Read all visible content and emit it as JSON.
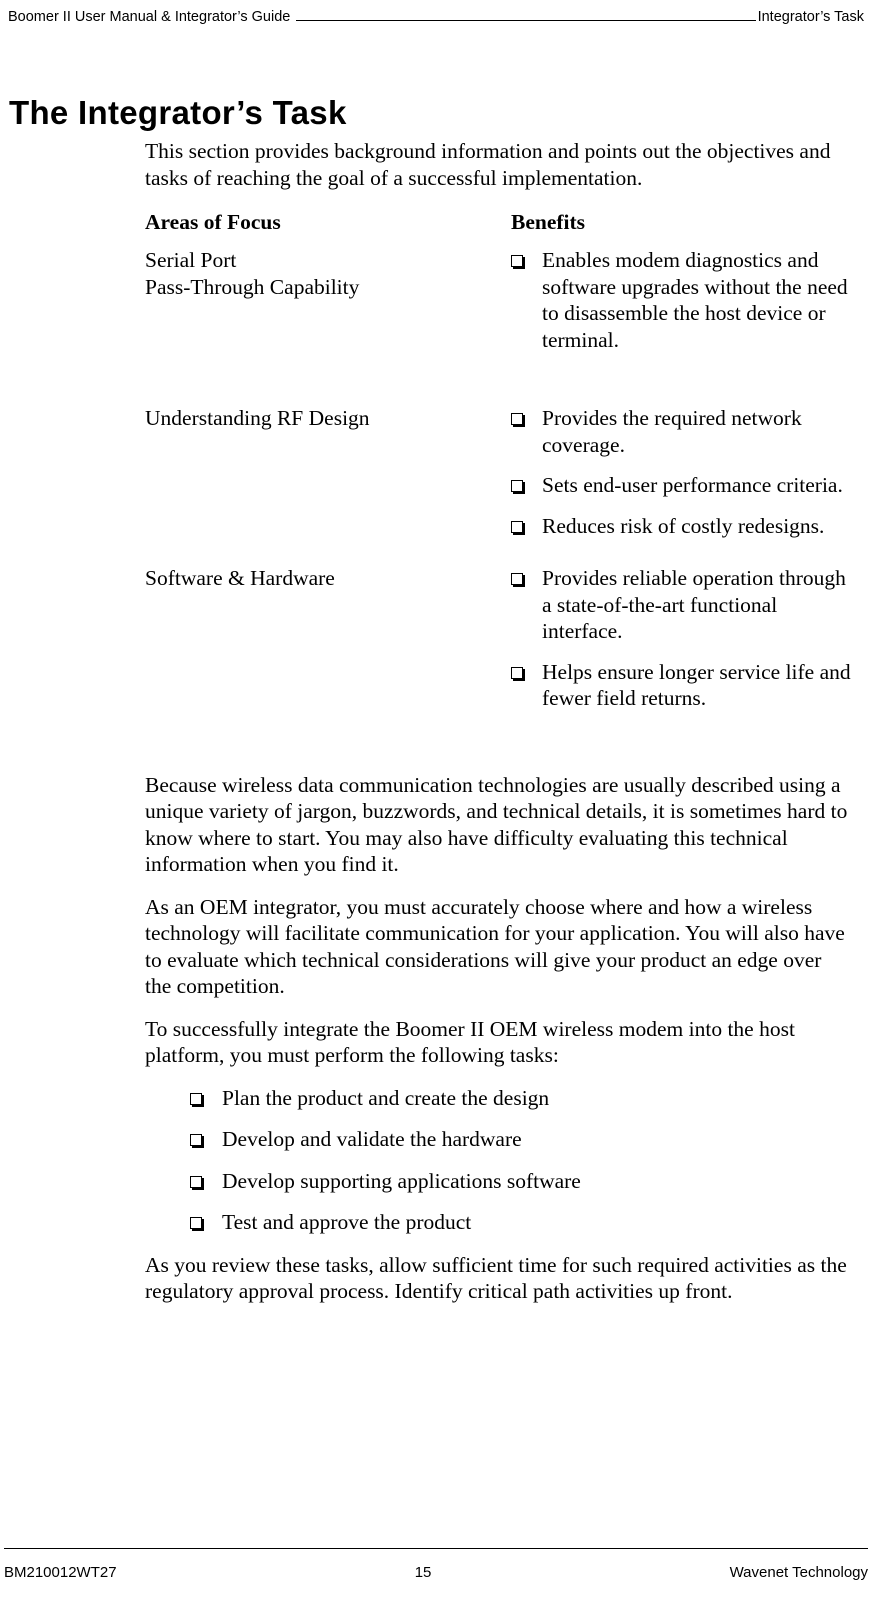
{
  "header": {
    "left_text": "Boomer II User Manual & Integrator’s Guide",
    "right_text": "Integrator’s Task"
  },
  "title": "The Integrator’s Task",
  "intro_paragraph": "This section provides background information and points out the objectives and tasks of reaching the goal of a successful implementation.",
  "focus_table": {
    "headers": {
      "focus": "Areas of Focus",
      "benefits": "Benefits"
    },
    "rows": [
      {
        "focus": "Serial Port\nPass-Through Capability",
        "focus_line1": "Serial Port",
        "focus_line2": "Pass-Through Capability",
        "benefits": [
          "Enables modem diagnostics and software upgrades without the need to disassemble the host device or terminal."
        ]
      },
      {
        "focus": "Understanding RF Design",
        "focus_line1": "Understanding RF Design",
        "focus_line2": "",
        "benefits": [
          "Provides the required network coverage.",
          "Sets end-user performance criteria.",
          "Reduces risk of costly redesigns."
        ]
      },
      {
        "focus": "Software & Hardware",
        "focus_line1": "Software & Hardware",
        "focus_line2": "",
        "benefits": [
          "Provides reliable operation through a state-of-the-art functional interface.",
          "Helps ensure longer service life and fewer field returns."
        ]
      }
    ]
  },
  "body_paragraphs": [
    "Because wireless data communication technologies are usually described using a unique variety of jargon, buzzwords, and technical details, it is sometimes hard to know where to start. You may also have difficulty evaluating this technical information when you find it.",
    "As an OEM integrator, you must accurately choose where and how a wireless technology will facilitate communication for your application. You will also have to evaluate which technical considerations will give your product an edge over the competition.",
    "To successfully integrate the Boomer II OEM wireless modem into the host platform, you must perform the following tasks:"
  ],
  "task_list": [
    "Plan the product and create the design",
    "Develop and validate the hardware",
    "Develop supporting applications software",
    "Test and approve the product"
  ],
  "closing_paragraph": "As you review these tasks, allow sufficient time for such required activities as the regulatory approval process. Identify critical path activities up front.",
  "footer": {
    "document_number": "BM210012WT27",
    "page_number": "15",
    "company": "Wavenet Technology"
  },
  "bullet_glyph": "hollow-square-shadow"
}
